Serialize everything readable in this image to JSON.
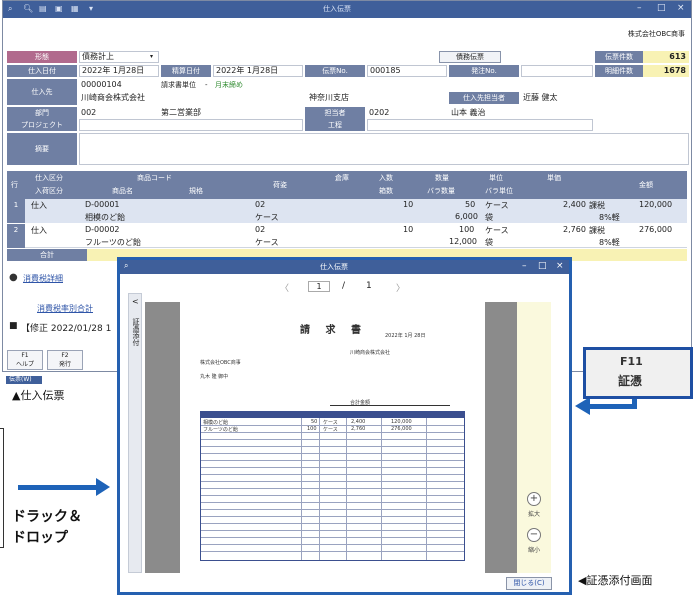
{
  "main": {
    "title": "仕入伝票",
    "company": "株式会社OBC商事",
    "header": {
      "kubun_label": "形態",
      "kubun_value": "債務計上",
      "date_label": "仕入日付",
      "date_value": "2022年 1月28日",
      "post_date_label": "精算日付",
      "post_date_value": "2022年 1月28日",
      "slip_no_label": "伝票No.",
      "slip_no_value": "000185",
      "order_no_label": "発注No.",
      "supplier_label": "仕入先",
      "supplier_code": "00000104",
      "supplier_name": "川崎商会株式会社",
      "billing_label": "請求書単位",
      "billing_value": "月末締め",
      "branch": "神奈川支店",
      "contact_label": "仕入先担当者",
      "contact_value": "近藤 健太",
      "dept_label": "部門",
      "dept_code": "002",
      "dept_name": "第二営業部",
      "staff_label": "担当者",
      "staff_code": "0202",
      "staff_name": "山本 義治",
      "project_label": "プロジェクト",
      "process_label": "工程",
      "memo_label": "摘要",
      "order_button": "債務伝票",
      "slip_count_label": "伝票件数",
      "slip_count": "613",
      "detail_count_label": "明細件数",
      "detail_count": "1678"
    },
    "table_headers": {
      "row": "行",
      "kubun": "仕入区分",
      "kubun2": "入荷区分",
      "product_code": "商品コード",
      "product_name": "商品名",
      "spec": "規格",
      "warehouse": "倉庫",
      "storage": "荷姿",
      "irisu": "入数",
      "hakosu": "箱数",
      "qty": "数量",
      "bara": "バラ数量",
      "unit": "単位",
      "bara_unit": "バラ単位",
      "price": "単価",
      "amount": "金額"
    },
    "rows": [
      {
        "no": "1",
        "kubun": "仕入",
        "code": "D-00001",
        "name": "相模のど飴",
        "storage": "02",
        "pack": "ケース",
        "irisu": "10",
        "qty": "50",
        "unit": "ケース",
        "bara": "6,000",
        "bara_unit": "袋",
        "price": "2,400",
        "tax": "課税",
        "tax_rate": "8%軽",
        "amount": "120,000"
      },
      {
        "no": "2",
        "kubun": "仕入",
        "code": "D-00002",
        "name": "フルーツのど飴",
        "storage": "02",
        "pack": "ケース",
        "irisu": "10",
        "qty": "100",
        "unit": "ケース",
        "bara": "12,000",
        "bara_unit": "袋",
        "price": "2,760",
        "tax": "課税",
        "tax_rate": "8%軽",
        "amount": "276,000"
      }
    ],
    "total_label": "合計",
    "tax_detail_link": "消費税詳細",
    "tax_sum_link": "消費税率別合計",
    "modified_note": "【修正 2022/01/28 1",
    "fkeys": [
      {
        "key": "F1",
        "label": "ヘルプ"
      },
      {
        "key": "F2",
        "label": "発行"
      }
    ],
    "status": "伝票(W)"
  },
  "captions": {
    "main_caption": "▲仕入伝票",
    "viewer_caption": "◀証憑添付画面",
    "drag_drop_line1": "ドラック＆",
    "drag_drop_line2": "ドロップ"
  },
  "f11": {
    "key": "F11",
    "label": "証憑"
  },
  "viewer": {
    "title": "仕入伝票",
    "side_tab": "証憑添付",
    "page_current": "1",
    "page_sep": "/",
    "page_total": "1",
    "zoom_in_label": "拡大",
    "zoom_out_label": "縮小",
    "close_button": "閉じる(C)",
    "doc": {
      "title": "請 求 書",
      "date": "2022年 1月 28日",
      "to_company": "株式会社OBC商事",
      "to_person": "丸木 隆 御中",
      "from_company": "川崎商会株式会社",
      "subtotal_label": "合計金額",
      "items": [
        {
          "name": "相模のど飴",
          "qty": "50",
          "unit": "ケース",
          "price": "2,400",
          "amount": "120,000"
        },
        {
          "name": "フルーツのど飴",
          "qty": "100",
          "unit": "ケース",
          "price": "2,760",
          "amount": "276,000"
        }
      ]
    }
  },
  "colors": {
    "accent": "#3f5f9a",
    "label_bg": "#6f7fa3",
    "highlight": "#1e63b8",
    "count_bg": "#f8f2b4"
  }
}
